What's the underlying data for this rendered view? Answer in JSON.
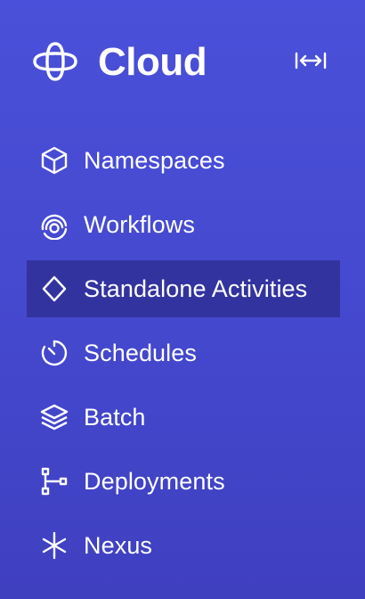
{
  "app": {
    "title": "Cloud",
    "logo_icon": "temporal-logo-icon",
    "collapse_icon": "expand-horizontal-icon"
  },
  "colors": {
    "background": "#4549cf",
    "active_item_background": "#3333a0",
    "text": "#ffffff"
  },
  "nav": {
    "items": [
      {
        "label": "Namespaces",
        "icon": "cube-icon",
        "active": false
      },
      {
        "label": "Workflows",
        "icon": "workflow-rings-icon",
        "active": false
      },
      {
        "label": "Standalone Activities",
        "icon": "diamond-icon",
        "active": true
      },
      {
        "label": "Schedules",
        "icon": "timer-icon",
        "active": false
      },
      {
        "label": "Batch",
        "icon": "layers-icon",
        "active": false
      },
      {
        "label": "Deployments",
        "icon": "deployment-nodes-icon",
        "active": false
      },
      {
        "label": "Nexus",
        "icon": "asterisk-icon",
        "active": false
      }
    ]
  }
}
